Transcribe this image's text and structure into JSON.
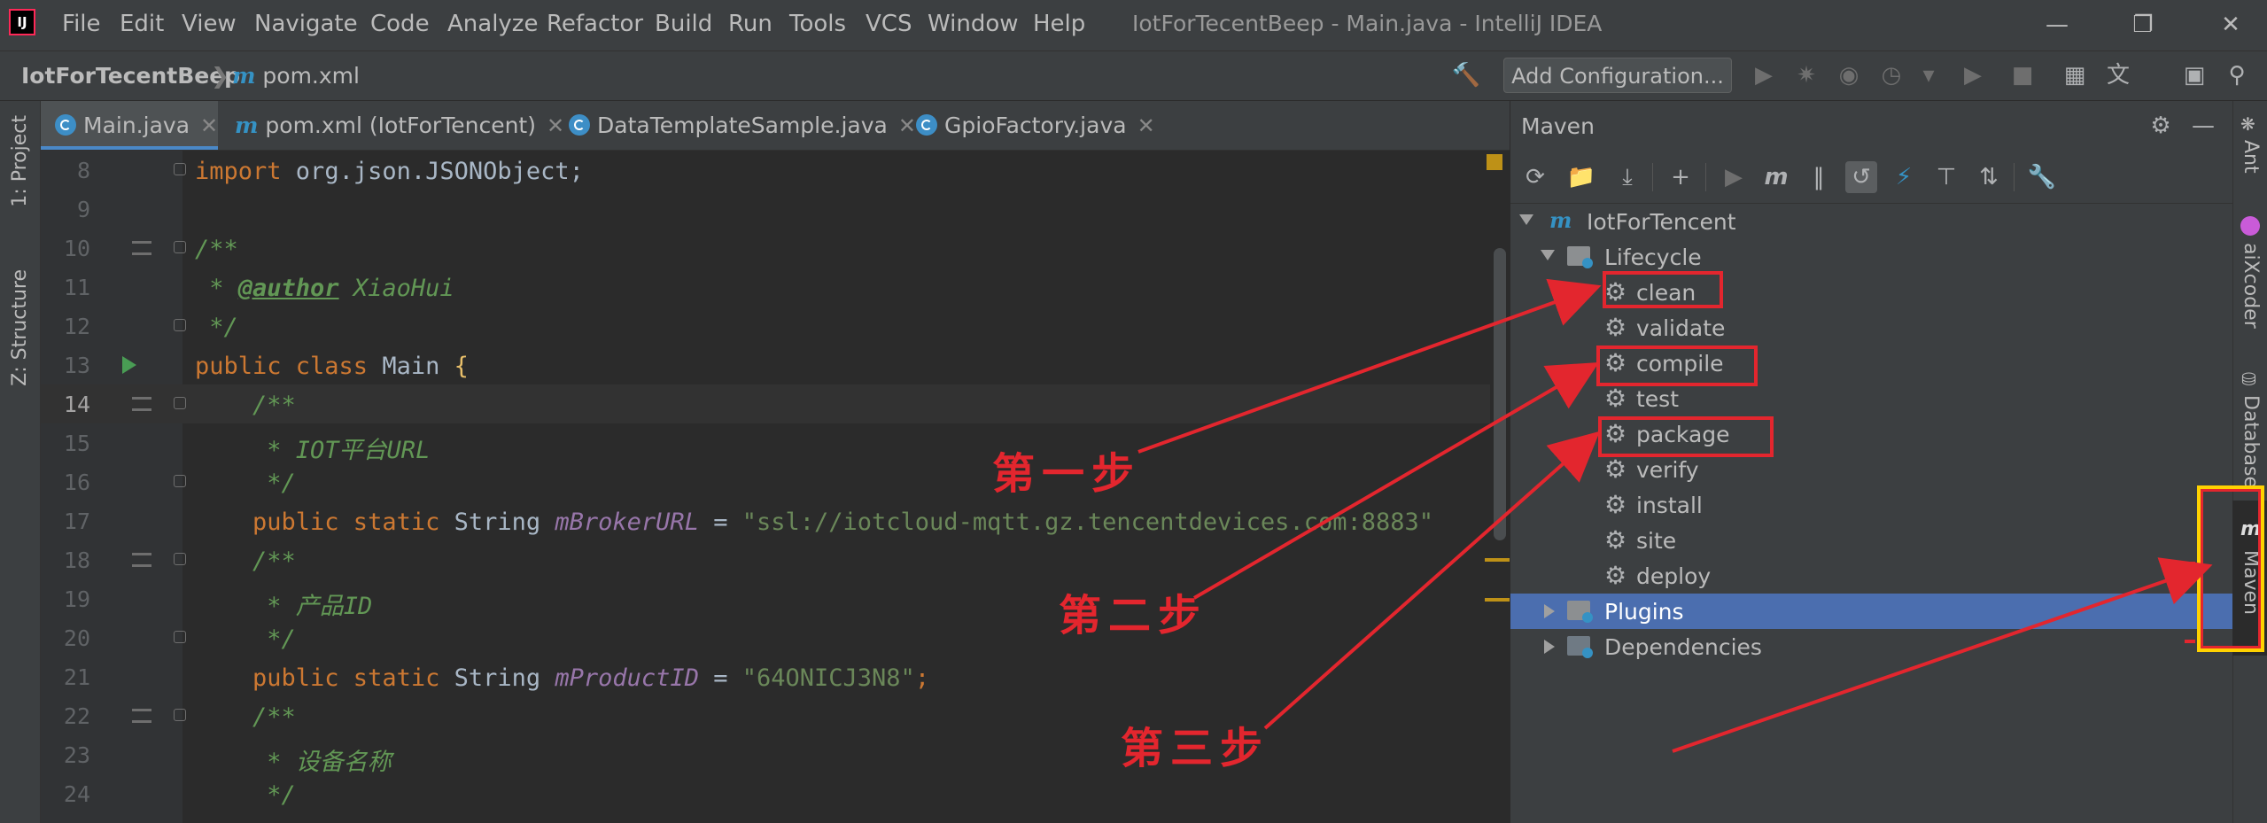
{
  "window": {
    "title": "IotForTecentBeep - Main.java - IntelliJ IDEA",
    "app_logo": "IJ"
  },
  "menu": [
    "File",
    "Edit",
    "View",
    "Navigate",
    "Code",
    "Analyze",
    "Refactor",
    "Build",
    "Run",
    "Tools",
    "VCS",
    "Window",
    "Help"
  ],
  "breadcrumb": {
    "project": "IotForTecentBeep",
    "file": "pom.xml"
  },
  "toolbar": {
    "add_configuration": "Add Configuration..."
  },
  "left_strip": {
    "project_tab": "1: Project",
    "structure_tab": "Z: Structure"
  },
  "tabs": [
    {
      "label": "Main.java",
      "icon": "class-icon",
      "active": true
    },
    {
      "label": "pom.xml (IotForTencent)",
      "icon": "maven-m-icon",
      "active": false
    },
    {
      "label": "DataTemplateSample.java",
      "icon": "class-icon",
      "active": false
    },
    {
      "label": "GpioFactory.java",
      "icon": "class-icon",
      "active": false
    }
  ],
  "code": {
    "line_numbers": [
      "8",
      "9",
      "10",
      "11",
      "12",
      "13",
      "14",
      "15",
      "16",
      "17",
      "18",
      "19",
      "20",
      "21",
      "22",
      "23",
      "24"
    ],
    "l8_kw": "import",
    "l8_rest": " org.json.JSONObject;",
    "l10": "/**",
    "l11_pre": " * ",
    "l11_tag": "@author",
    "l11_rest": " XiaoHui",
    "l12": " */",
    "l13_kw": "public class",
    "l13_name": " Main ",
    "l13_brace": "{",
    "l14": "    /**",
    "l15": "     * IOT平台URL",
    "l16": "     */",
    "l17_kw": "    public static",
    "l17_type": " String ",
    "l17_field": "mBrokerURL",
    "l17_eq": " = ",
    "l17_str": "\"ssl://iotcloud-mqtt.gz.tencentdevices.com:8883\"",
    "l18": "    /**",
    "l19": "     * 产品ID",
    "l20": "     */",
    "l21_kw": "    public static",
    "l21_type": " String ",
    "l21_field": "mProductID",
    "l21_eq": " = ",
    "l21_str": "\"64ONICJ3N8\"",
    "l21_end": ";",
    "l22": "    /**",
    "l23": "     * 设备名称",
    "l24": "     */"
  },
  "maven": {
    "title": "Maven",
    "root": "IotForTencent",
    "lifecycle": "Lifecycle",
    "goals": [
      "clean",
      "validate",
      "compile",
      "test",
      "package",
      "verify",
      "install",
      "site",
      "deploy"
    ],
    "plugins": "Plugins",
    "dependencies": "Dependencies"
  },
  "right_strip": {
    "ant": "Ant",
    "aixcoder": "aiXcoder",
    "database": "Database",
    "maven": "Maven"
  },
  "annotations": {
    "step1": "第一步",
    "step2": "第二步",
    "step3": "第三步",
    "color": "#e3262e"
  }
}
